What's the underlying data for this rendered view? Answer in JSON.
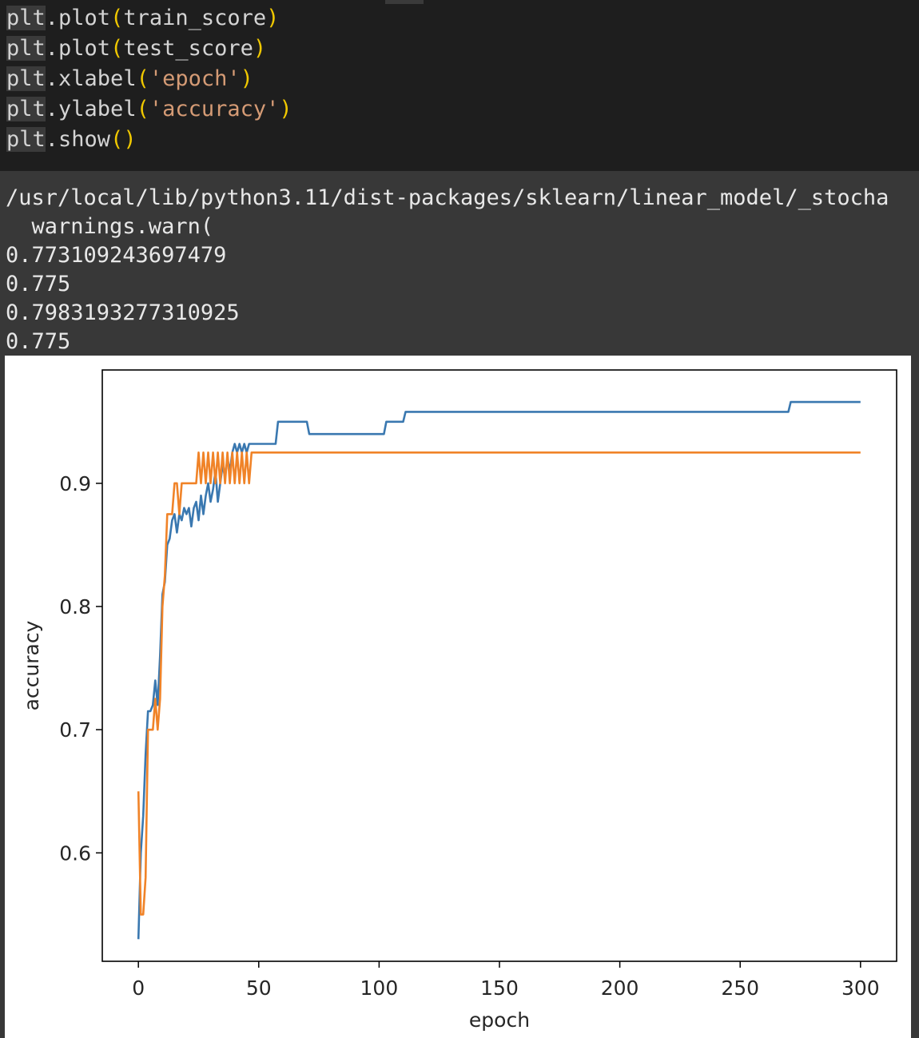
{
  "code": {
    "lines": [
      {
        "obj": "plt",
        "rest": ".plot",
        "open": "(",
        "arg": "train_score",
        "close": ")",
        "is_str": false
      },
      {
        "obj": "plt",
        "rest": ".plot",
        "open": "(",
        "arg": "test_score",
        "close": ")",
        "is_str": false
      },
      {
        "obj": "plt",
        "rest": ".xlabel",
        "open": "(",
        "arg": "'epoch'",
        "close": ")",
        "is_str": true
      },
      {
        "obj": "plt",
        "rest": ".ylabel",
        "open": "(",
        "arg": "'accuracy'",
        "close": ")",
        "is_str": true
      },
      {
        "obj": "plt",
        "rest": ".show",
        "open": "(",
        "arg": "",
        "close": ")",
        "is_str": false
      }
    ]
  },
  "output": {
    "lines": [
      "/usr/local/lib/python3.11/dist-packages/sklearn/linear_model/_stocha",
      "  warnings.warn(",
      "0.773109243697479",
      "0.775",
      "0.7983193277310925",
      "0.775"
    ]
  },
  "colors": {
    "train": "#3a78b0",
    "test": "#f08328",
    "code_bg": "#1e1e1e",
    "output_bg": "#383838"
  },
  "chart_data": {
    "type": "line",
    "xlabel": "epoch",
    "ylabel": "accuracy",
    "xlim": [
      -15,
      315
    ],
    "ylim": [
      0.512,
      0.992
    ],
    "xticks": [
      0,
      50,
      100,
      150,
      200,
      250,
      300
    ],
    "yticks": [
      0.6,
      0.7,
      0.8,
      0.9
    ],
    "ytick_labels": [
      "0.6",
      "0.7",
      "0.8",
      "0.9"
    ],
    "grid": false,
    "series": [
      {
        "color": "#3a78b0",
        "points": [
          [
            0,
            0.53
          ],
          [
            1,
            0.6
          ],
          [
            2,
            0.63
          ],
          [
            3,
            0.68
          ],
          [
            4,
            0.715
          ],
          [
            5,
            0.715
          ],
          [
            6,
            0.72
          ],
          [
            7,
            0.74
          ],
          [
            8,
            0.72
          ],
          [
            9,
            0.76
          ],
          [
            10,
            0.81
          ],
          [
            11,
            0.82
          ],
          [
            12,
            0.85
          ],
          [
            13,
            0.855
          ],
          [
            14,
            0.87
          ],
          [
            15,
            0.875
          ],
          [
            16,
            0.86
          ],
          [
            17,
            0.875
          ],
          [
            18,
            0.87
          ],
          [
            19,
            0.88
          ],
          [
            20,
            0.875
          ],
          [
            21,
            0.88
          ],
          [
            22,
            0.865
          ],
          [
            23,
            0.88
          ],
          [
            24,
            0.885
          ],
          [
            25,
            0.87
          ],
          [
            26,
            0.89
          ],
          [
            27,
            0.875
          ],
          [
            28,
            0.89
          ],
          [
            29,
            0.9
          ],
          [
            30,
            0.885
          ],
          [
            31,
            0.895
          ],
          [
            32,
            0.91
          ],
          [
            33,
            0.885
          ],
          [
            34,
            0.9
          ],
          [
            35,
            0.915
          ],
          [
            36,
            0.905
          ],
          [
            37,
            0.92
          ],
          [
            38,
            0.91
          ],
          [
            39,
            0.925
          ],
          [
            40,
            0.932
          ],
          [
            41,
            0.925
          ],
          [
            42,
            0.932
          ],
          [
            43,
            0.925
          ],
          [
            44,
            0.932
          ],
          [
            45,
            0.925
          ],
          [
            46,
            0.932
          ],
          [
            57,
            0.932
          ],
          [
            58,
            0.95
          ],
          [
            70,
            0.95
          ],
          [
            71,
            0.94
          ],
          [
            102,
            0.94
          ],
          [
            103,
            0.95
          ],
          [
            110,
            0.95
          ],
          [
            111,
            0.958
          ],
          [
            270,
            0.958
          ],
          [
            271,
            0.966
          ],
          [
            300,
            0.966
          ]
        ]
      },
      {
        "color": "#f08328",
        "points": [
          [
            0,
            0.65
          ],
          [
            1,
            0.55
          ],
          [
            2,
            0.55
          ],
          [
            3,
            0.58
          ],
          [
            4,
            0.7
          ],
          [
            5,
            0.7
          ],
          [
            6,
            0.7
          ],
          [
            7,
            0.725
          ],
          [
            8,
            0.7
          ],
          [
            9,
            0.725
          ],
          [
            10,
            0.8
          ],
          [
            11,
            0.825
          ],
          [
            12,
            0.875
          ],
          [
            13,
            0.875
          ],
          [
            14,
            0.875
          ],
          [
            15,
            0.9
          ],
          [
            16,
            0.9
          ],
          [
            17,
            0.875
          ],
          [
            18,
            0.9
          ],
          [
            19,
            0.9
          ],
          [
            24,
            0.9
          ],
          [
            25,
            0.925
          ],
          [
            26,
            0.9
          ],
          [
            27,
            0.925
          ],
          [
            28,
            0.9
          ],
          [
            29,
            0.925
          ],
          [
            30,
            0.9
          ],
          [
            31,
            0.925
          ],
          [
            32,
            0.9
          ],
          [
            33,
            0.925
          ],
          [
            34,
            0.9
          ],
          [
            35,
            0.925
          ],
          [
            36,
            0.9
          ],
          [
            37,
            0.925
          ],
          [
            38,
            0.9
          ],
          [
            39,
            0.925
          ],
          [
            40,
            0.9
          ],
          [
            41,
            0.925
          ],
          [
            42,
            0.9
          ],
          [
            43,
            0.925
          ],
          [
            44,
            0.9
          ],
          [
            45,
            0.925
          ],
          [
            46,
            0.9
          ],
          [
            47,
            0.925
          ],
          [
            48,
            0.925
          ],
          [
            300,
            0.925
          ]
        ]
      }
    ]
  }
}
